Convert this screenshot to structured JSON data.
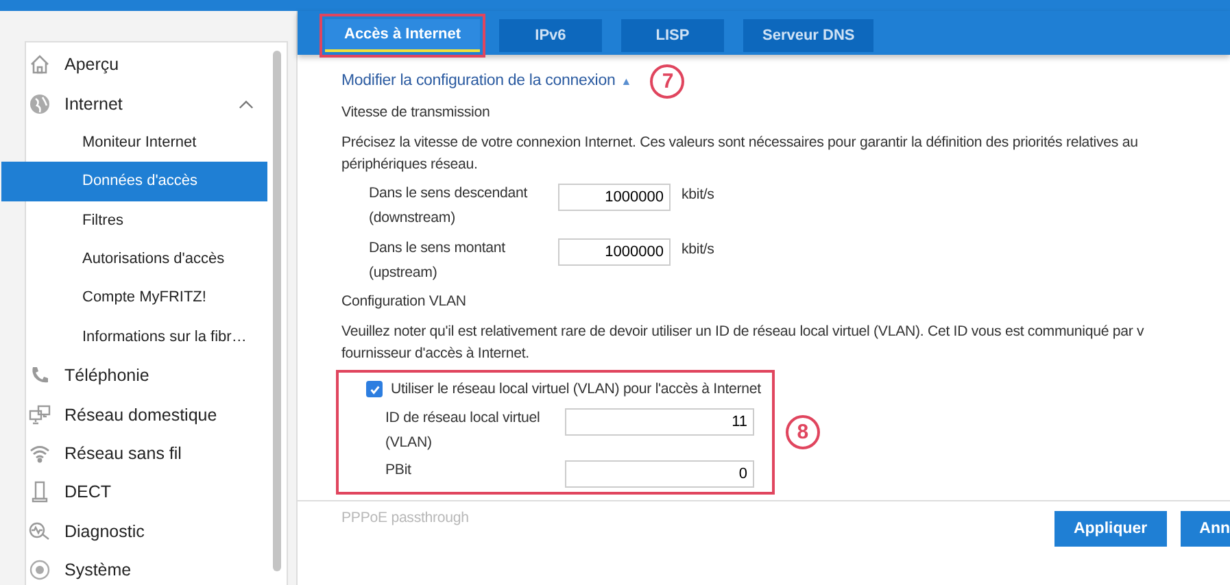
{
  "sidebar": {
    "items": [
      {
        "label": "Aperçu",
        "selected": false
      },
      {
        "label": "Internet",
        "selected": false,
        "expanded": true,
        "children": [
          {
            "label": "Moniteur Internet",
            "selected": false
          },
          {
            "label": "Données d'accès",
            "selected": true
          },
          {
            "label": "Filtres",
            "selected": false
          },
          {
            "label": "Autorisations d'accès",
            "selected": false
          },
          {
            "label": "Compte MyFRITZ!",
            "selected": false
          },
          {
            "label": "Informations sur la fibr…",
            "selected": false
          }
        ]
      },
      {
        "label": "Téléphonie",
        "selected": false
      },
      {
        "label": "Réseau domestique",
        "selected": false
      },
      {
        "label": "Réseau sans fil",
        "selected": false
      },
      {
        "label": "DECT",
        "selected": false
      },
      {
        "label": "Diagnostic",
        "selected": false
      },
      {
        "label": "Système",
        "selected": false
      }
    ]
  },
  "tabs": [
    {
      "label": "Accès à Internet",
      "selected": true
    },
    {
      "label": "IPv6",
      "selected": false
    },
    {
      "label": "LISP",
      "selected": false
    },
    {
      "label": "Serveur DNS",
      "selected": false
    }
  ],
  "annotations": [
    {
      "number": "7"
    },
    {
      "number": "8"
    }
  ],
  "content": {
    "link": "Modifier la configuration de la connexion",
    "link_arrow": "▲",
    "speed": {
      "heading": "Vitesse de transmission",
      "text": "Précisez la vitesse de votre connexion Internet. Ces valeurs sont nécessaires pour garantir la définition des priorités relatives au",
      "text_2": "périphériques réseau.",
      "fields": [
        {
          "label": "Dans le sens descendant (downstream)",
          "value": "1000000",
          "unit": "kbit/s"
        },
        {
          "label": "Dans le sens montant (upstream)",
          "value": "1000000",
          "unit": "kbit/s"
        }
      ]
    },
    "vlan": {
      "heading": "Configuration VLAN",
      "text": "Veuillez noter qu'il est relativement rare de devoir utiliser un ID de réseau local virtuel (VLAN). Cet ID vous est communiqué par v",
      "text_2": "fournisseur d'accès à Internet.",
      "checkbox": {
        "label": "Utiliser le réseau local virtuel (VLAN) pour l'accès à Internet",
        "checked": true
      },
      "fields": [
        {
          "label": "ID de réseau local virtuel (VLAN)",
          "value": "11"
        },
        {
          "label": "PBit",
          "value": "0"
        }
      ]
    },
    "faded_heading": "PPPoE passthrough"
  },
  "buttons": [
    {
      "label": "Appliquer"
    },
    {
      "label": "Ann"
    }
  ]
}
